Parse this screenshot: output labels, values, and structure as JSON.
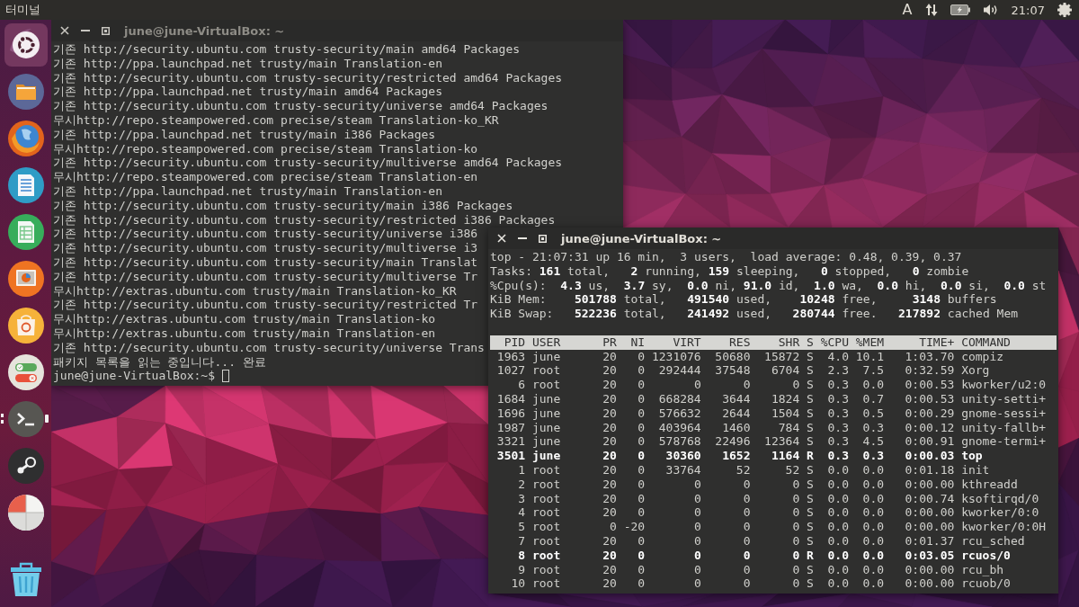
{
  "top_panel": {
    "app_title": "터미널",
    "keyboard_indicator": "A",
    "clock": "21:07"
  },
  "launcher": [
    {
      "kind": "dash",
      "running": false,
      "focused": false
    },
    {
      "kind": "folder",
      "running": false,
      "focused": false
    },
    {
      "kind": "browser",
      "running": false,
      "focused": false
    },
    {
      "kind": "document",
      "running": false,
      "focused": false
    },
    {
      "kind": "spreadsheet",
      "running": false,
      "focused": false
    },
    {
      "kind": "presentation",
      "running": false,
      "focused": false
    },
    {
      "kind": "store",
      "running": false,
      "focused": false
    },
    {
      "kind": "settings",
      "running": false,
      "focused": false
    },
    {
      "kind": "terminal",
      "running": true,
      "focused": true
    },
    {
      "kind": "game",
      "running": false,
      "focused": false
    },
    {
      "kind": "disk",
      "running": false,
      "focused": false
    },
    {
      "kind": "trash",
      "running": false,
      "focused": false
    }
  ],
  "back_terminal": {
    "title": "june@june-VirtualBox: ~",
    "focused": false,
    "lines": [
      "기존 http://security.ubuntu.com trusty-security/main amd64 Packages",
      "기존 http://ppa.launchpad.net trusty/main Translation-en",
      "기존 http://security.ubuntu.com trusty-security/restricted amd64 Packages",
      "기존 http://ppa.launchpad.net trusty/main amd64 Packages",
      "기존 http://security.ubuntu.com trusty-security/universe amd64 Packages",
      "무시http://repo.steampowered.com precise/steam Translation-ko_KR",
      "기존 http://ppa.launchpad.net trusty/main i386 Packages",
      "무시http://repo.steampowered.com precise/steam Translation-ko",
      "기존 http://security.ubuntu.com trusty-security/multiverse amd64 Packages",
      "무시http://repo.steampowered.com precise/steam Translation-en",
      "기존 http://ppa.launchpad.net trusty/main Translation-en",
      "기존 http://security.ubuntu.com trusty-security/main i386 Packages",
      "기존 http://security.ubuntu.com trusty-security/restricted i386 Packages",
      "기존 http://security.ubuntu.com trusty-security/universe i386",
      "기존 http://security.ubuntu.com trusty-security/multiverse i3",
      "기존 http://security.ubuntu.com trusty-security/main Translat",
      "기존 http://security.ubuntu.com trusty-security/multiverse Tr",
      "무시http://extras.ubuntu.com trusty/main Translation-ko_KR",
      "기존 http://security.ubuntu.com trusty-security/restricted Tr",
      "무시http://extras.ubuntu.com trusty/main Translation-ko",
      "무시http://extras.ubuntu.com trusty/main Translation-en",
      "기존 http://security.ubuntu.com trusty-security/universe Trans",
      "패키지 목록을 읽는 중입니다... 완료"
    ],
    "prompt": "june@june-VirtualBox:~$"
  },
  "top_terminal": {
    "title": "june@june-VirtualBox: ~",
    "focused": true,
    "summary": [
      "top - 21:07:31 up 16 min,  3 users,  load average: 0.48, 0.39, 0.37",
      "Tasks: **161** total,   **2** running, **159** sleeping,   **0** stopped,   **0** zombie",
      "%Cpu(s):  **4.3** us,  **3.7** sy,  **0.0** ni, **91.0** id,  **1.0** wa,  **0.0** hi,  **0.0** si,  **0.0** st",
      "KiB Mem:    **501788** total,   **491540** used,    **10248** free,     **3148** buffers",
      "KiB Swap:   **522236** total,   **241492** used,   **280744** free.   **217892** cached Mem"
    ],
    "table": {
      "columns": [
        "PID",
        "USER",
        "PR",
        "NI",
        "VIRT",
        "RES",
        "SHR",
        "S",
        "%CPU",
        "%MEM",
        "TIME+",
        "COMMAND"
      ],
      "rows": [
        {
          "cells": [
            "1963",
            "june",
            "20",
            "0",
            "1231076",
            "50680",
            "15872",
            "S",
            "4.0",
            "10.1",
            "1:03.70",
            "compiz"
          ],
          "highlighted": false
        },
        {
          "cells": [
            "1027",
            "root",
            "20",
            "0",
            "292444",
            "37548",
            "6704",
            "S",
            "2.3",
            "7.5",
            "0:32.59",
            "Xorg"
          ],
          "highlighted": false
        },
        {
          "cells": [
            "6",
            "root",
            "20",
            "0",
            "0",
            "0",
            "0",
            "S",
            "0.3",
            "0.0",
            "0:00.53",
            "kworker/u2:0"
          ],
          "highlighted": false
        },
        {
          "cells": [
            "1684",
            "june",
            "20",
            "0",
            "668284",
            "3644",
            "1824",
            "S",
            "0.3",
            "0.7",
            "0:00.53",
            "unity-setti+"
          ],
          "highlighted": false
        },
        {
          "cells": [
            "1696",
            "june",
            "20",
            "0",
            "576632",
            "2644",
            "1504",
            "S",
            "0.3",
            "0.5",
            "0:00.29",
            "gnome-sessi+"
          ],
          "highlighted": false
        },
        {
          "cells": [
            "1987",
            "june",
            "20",
            "0",
            "403964",
            "1460",
            "784",
            "S",
            "0.3",
            "0.3",
            "0:00.12",
            "unity-fallb+"
          ],
          "highlighted": false
        },
        {
          "cells": [
            "3321",
            "june",
            "20",
            "0",
            "578768",
            "22496",
            "12364",
            "S",
            "0.3",
            "4.5",
            "0:00.91",
            "gnome-termi+"
          ],
          "highlighted": false
        },
        {
          "cells": [
            "3501",
            "june",
            "20",
            "0",
            "30360",
            "1652",
            "1164",
            "R",
            "0.3",
            "0.3",
            "0:00.03",
            "top"
          ],
          "highlighted": true
        },
        {
          "cells": [
            "1",
            "root",
            "20",
            "0",
            "33764",
            "52",
            "52",
            "S",
            "0.0",
            "0.0",
            "0:01.18",
            "init"
          ],
          "highlighted": false
        },
        {
          "cells": [
            "2",
            "root",
            "20",
            "0",
            "0",
            "0",
            "0",
            "S",
            "0.0",
            "0.0",
            "0:00.00",
            "kthreadd"
          ],
          "highlighted": false
        },
        {
          "cells": [
            "3",
            "root",
            "20",
            "0",
            "0",
            "0",
            "0",
            "S",
            "0.0",
            "0.0",
            "0:00.74",
            "ksoftirqd/0"
          ],
          "highlighted": false
        },
        {
          "cells": [
            "4",
            "root",
            "20",
            "0",
            "0",
            "0",
            "0",
            "S",
            "0.0",
            "0.0",
            "0:00.00",
            "kworker/0:0"
          ],
          "highlighted": false
        },
        {
          "cells": [
            "5",
            "root",
            "0",
            "-20",
            "0",
            "0",
            "0",
            "S",
            "0.0",
            "0.0",
            "0:00.00",
            "kworker/0:0H"
          ],
          "highlighted": false
        },
        {
          "cells": [
            "7",
            "root",
            "20",
            "0",
            "0",
            "0",
            "0",
            "S",
            "0.0",
            "0.0",
            "0:01.37",
            "rcu_sched"
          ],
          "highlighted": false
        },
        {
          "cells": [
            "8",
            "root",
            "20",
            "0",
            "0",
            "0",
            "0",
            "R",
            "0.0",
            "0.0",
            "0:03.05",
            "rcuos/0"
          ],
          "highlighted": true
        },
        {
          "cells": [
            "9",
            "root",
            "20",
            "0",
            "0",
            "0",
            "0",
            "S",
            "0.0",
            "0.0",
            "0:00.00",
            "rcu_bh"
          ],
          "highlighted": false
        },
        {
          "cells": [
            "10",
            "root",
            "20",
            "0",
            "0",
            "0",
            "0",
            "S",
            "0.0",
            "0.0",
            "0:00.00",
            "rcuob/0"
          ],
          "highlighted": false
        }
      ]
    }
  }
}
